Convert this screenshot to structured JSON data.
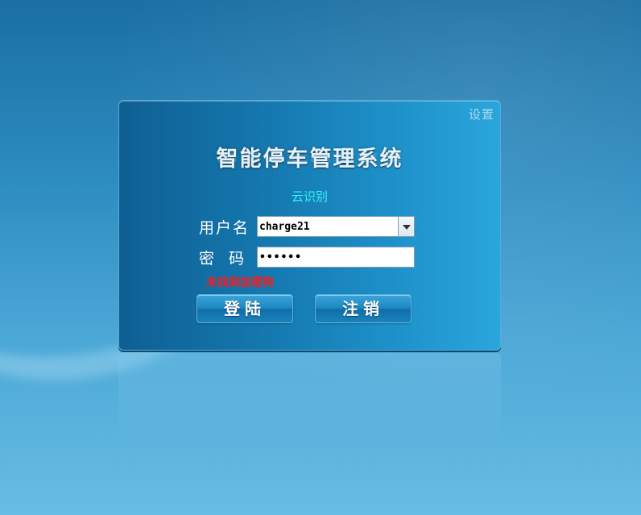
{
  "window": {
    "settings_label": "设置",
    "title": "智能停车管理系统",
    "subtitle": "云识别"
  },
  "form": {
    "username_label": "用户名",
    "username_value": "charge21",
    "password_label": "密码",
    "password_value": "••••••",
    "error_message": "未找到加密狗"
  },
  "buttons": {
    "login_label": "登陆",
    "logout_label": "注销"
  },
  "colors": {
    "subtitle": "#2ff5ff",
    "error": "#ff1a1a",
    "panel": "#1579b0"
  },
  "icons": {
    "combo_arrow": "chevron-down-icon"
  }
}
